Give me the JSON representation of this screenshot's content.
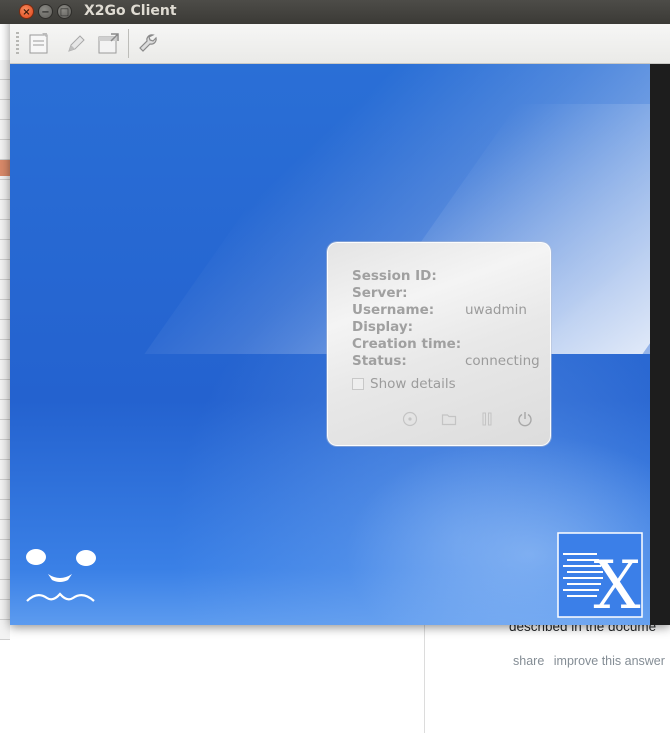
{
  "window": {
    "title": "X2Go Client",
    "controls": {
      "close": "×",
      "minimize": "−",
      "maximize": "□"
    }
  },
  "toolbar": {
    "items": [
      {
        "name": "new-session",
        "icon": "new-document-icon"
      },
      {
        "name": "edit-session",
        "icon": "pencil-icon"
      },
      {
        "name": "export-session",
        "icon": "export-window-icon"
      },
      {
        "name": "settings",
        "icon": "wrench-icon"
      }
    ]
  },
  "session_card": {
    "fields": [
      {
        "label": "Session ID:",
        "value": ""
      },
      {
        "label": "Server:",
        "value": ""
      },
      {
        "label": "Username:",
        "value": "uwadmin"
      },
      {
        "label": "Display:",
        "value": ""
      },
      {
        "label": "Creation time:",
        "value": ""
      },
      {
        "label": "Status:",
        "value": "connecting"
      }
    ],
    "show_details_label": "Show details",
    "show_details_checked": false,
    "actions": [
      "resume-icon",
      "folder-icon",
      "pause-icon",
      "power-icon"
    ]
  },
  "background": {
    "partial_text": "described in the docume",
    "links": [
      "share",
      "improve this answer"
    ]
  },
  "colors": {
    "desktop_blue": "#2462cf",
    "titlebar": "#3b3a36",
    "close_button": "#e0451b"
  }
}
